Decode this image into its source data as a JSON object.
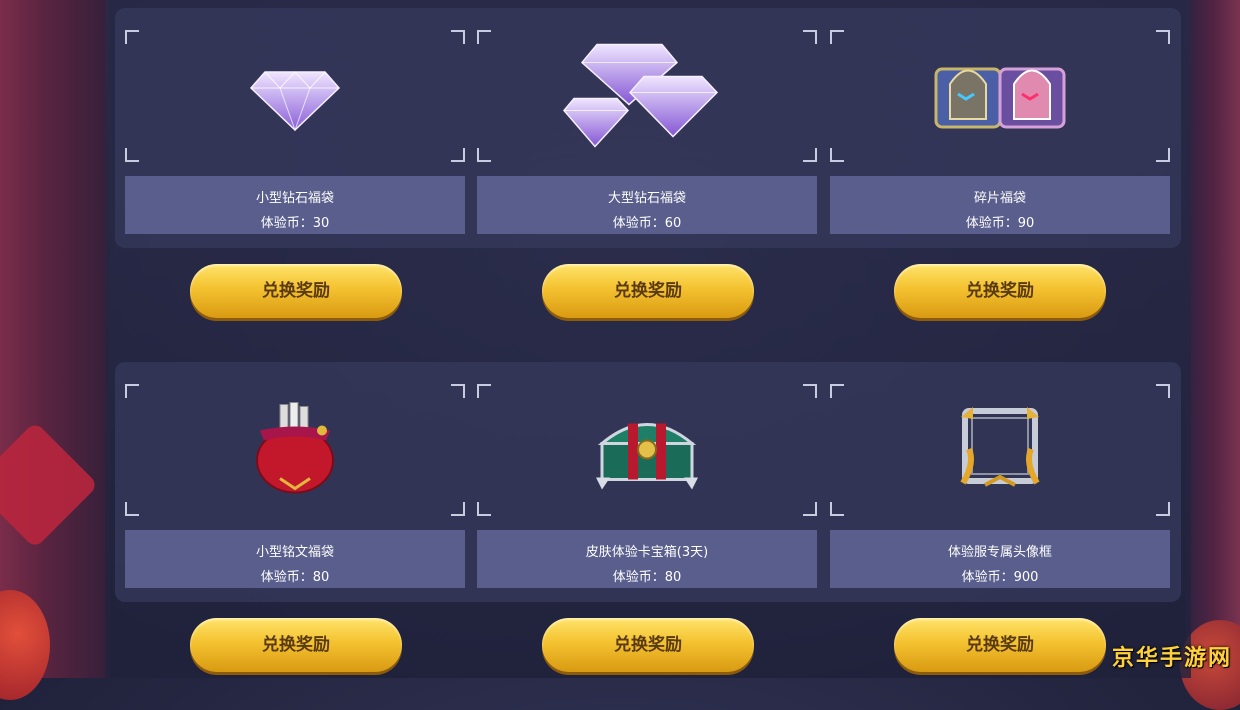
{
  "rows": [
    [
      {
        "name": "小型钻石福袋",
        "price": "体验币：30",
        "button": "兑换奖励",
        "icon": "small-diamond-bag"
      },
      {
        "name": "大型钻石福袋",
        "price": "体验币：60",
        "button": "兑换奖励",
        "icon": "large-diamond-bag"
      },
      {
        "name": "碎片福袋",
        "price": "体验币：90",
        "button": "兑换奖励",
        "icon": "fragment-bag"
      }
    ],
    [
      {
        "name": "小型铭文福袋",
        "price": "体验币：80",
        "button": "兑换奖励",
        "icon": "inscription-bag"
      },
      {
        "name": "皮肤体验卡宝箱(3天)",
        "price": "体验币：80",
        "button": "兑换奖励",
        "icon": "skin-card-chest"
      },
      {
        "name": "体验服专属头像框",
        "price": "体验币：900",
        "button": "兑换奖励",
        "icon": "avatar-frame"
      }
    ]
  ],
  "watermark": "京华手游网",
  "colors": {
    "button_gold": "#f4c230",
    "info_bg": "#5a5e8c",
    "panel_bg": "#373a5c"
  }
}
